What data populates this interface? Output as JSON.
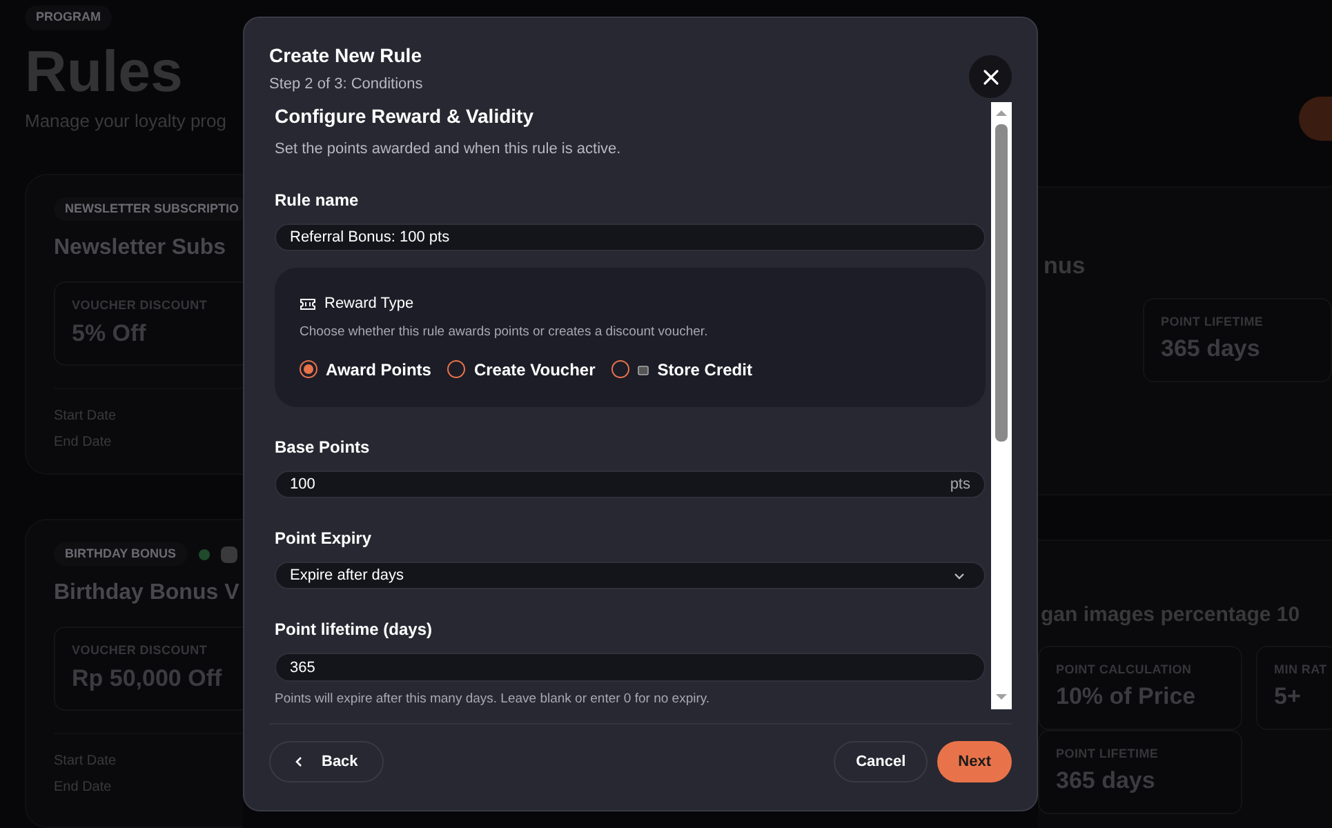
{
  "page": {
    "badge": "PROGRAM",
    "title": "Rules",
    "subtitle": "Manage your loyalty prog"
  },
  "cards": [
    {
      "badge": "NEWSLETTER SUBSCRIPTIO",
      "status_dot": false,
      "title_left": "Newsletter Subs",
      "title_right": "nus",
      "stats_left": [
        {
          "label": "VOUCHER DISCOUNT",
          "value": "5% Off"
        }
      ],
      "stats_right": [
        {
          "label": "POINT LIFETIME",
          "value": "365 days"
        }
      ],
      "dates": [
        "Start Date",
        "End Date"
      ]
    },
    {
      "badge": "BIRTHDAY BONUS",
      "status_dot": true,
      "title_left": "Birthday Bonus V",
      "title_right": "gan images percentage 10",
      "stats_left": [
        {
          "label": "VOUCHER DISCOUNT",
          "value": "Rp 50,000 Off"
        }
      ],
      "stats_right": [
        {
          "label": "POINT CALCULATION",
          "value": "10% of Price"
        },
        {
          "label": "MIN RAT",
          "value": "5+"
        },
        {
          "label": "POINT LIFETIME",
          "value": "365 days"
        }
      ],
      "dates": [
        "Start Date",
        "End Date"
      ]
    }
  ],
  "modal": {
    "title": "Create New Rule",
    "step": "Step 2 of 3: Conditions",
    "section_title": "Configure Reward & Validity",
    "section_desc": "Set the points awarded and when this rule is active.",
    "rule_name": {
      "label": "Rule name",
      "value": "Referral Bonus: 100 pts"
    },
    "reward_type": {
      "title": "Reward Type",
      "desc": "Choose whether this rule awards points or creates a discount voucher.",
      "options": [
        {
          "label": "Award Points",
          "selected": true,
          "icon": false
        },
        {
          "label": "Create Voucher",
          "selected": false,
          "icon": false
        },
        {
          "label": "Store Credit",
          "selected": false,
          "icon": true
        }
      ]
    },
    "base_points": {
      "label": "Base Points",
      "value": "100",
      "suffix": "pts"
    },
    "point_expiry": {
      "label": "Point Expiry",
      "value": "Expire after days"
    },
    "point_lifetime": {
      "label": "Point lifetime (days)",
      "value": "365",
      "hint": "Points will expire after this many days. Leave blank or enter 0 for no expiry."
    },
    "buttons": {
      "back": "Back",
      "cancel": "Cancel",
      "next": "Next"
    }
  }
}
